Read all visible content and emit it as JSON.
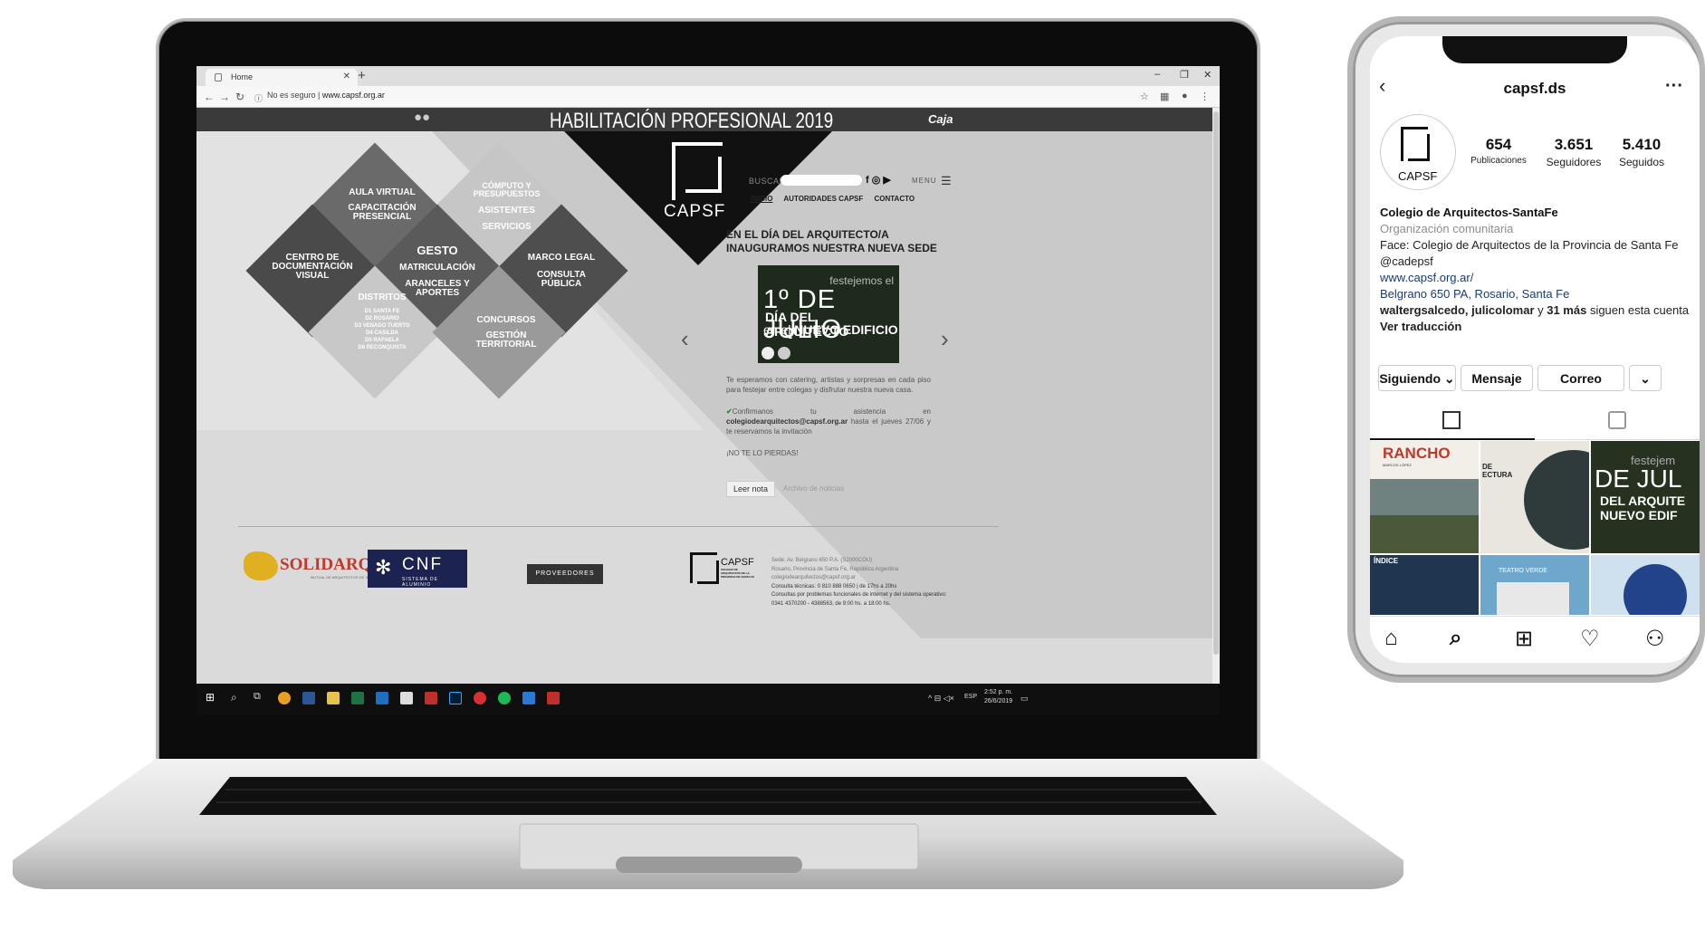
{
  "browser": {
    "tab_title": "Home",
    "new_tab": "+",
    "security_label": "No es seguro",
    "url": "www.capsf.org.ar",
    "window_controls": [
      "–",
      "❐",
      "✕"
    ]
  },
  "site": {
    "banner_title": "HABILITACIÓN PROFESIONAL 2019",
    "banner_sponsor": "Caja",
    "logo_text": "CAPSF",
    "search_label": "BUSCAR",
    "menu_label": "MENU",
    "nav": [
      "INICIO",
      "AUTORIDADES CAPSF",
      "CONTACTO"
    ],
    "diamonds": {
      "aula": "AULA VIRTUAL",
      "capacitacion": "CAPACITACIÓN PRESENCIAL",
      "computo": "CÓMPUTO Y PRESUPUESTOS",
      "asistentes": "ASISTENTES",
      "servicios": "SERVICIOS",
      "centro": "CENTRO DE DOCUMENTACIÓN VISUAL",
      "gesto": "GESTO",
      "matriculacion": "MATRICULACIÓN",
      "aranceles": "ARANCELES Y APORTES",
      "marco": "MARCO LEGAL",
      "consulta": "CONSULTA PÚBLICA",
      "distritos": "DISTRITOS",
      "distritos_list": [
        "D1 SANTA FE",
        "D2 ROSARIO",
        "D3 VENADO TUERTO",
        "D4 CASILDA",
        "D5 RAFAELA",
        "D6 RECONQUISTA"
      ],
      "concursos": "CONCURSOS",
      "gestion": "GESTIÓN TERRITORIAL"
    },
    "news": {
      "headline": "EN EL DÍA DEL ARQUITECTO/A INAUGURAMOS NUESTRA NUEVA SEDE",
      "promo_line1": "festejemos el",
      "promo_line2": "1º DE JULIO",
      "promo_line3": "DÍA DEL ARQUITECTO",
      "promo_line4a": "en el",
      "promo_line4b": "NUEVO EDIFICIO",
      "body": "Te esperamos con catering, artistas y sorpresas en cada piso para festejar entre colegas y disfrutar nuestra nueva casa.",
      "confirm_a": "Confirmanos tu asistencia en",
      "confirm_email": "colegiodearquitectos@capsf.org.ar",
      "confirm_b": "hasta el jueves 27/06 y te reservamos la invitación",
      "closing": "¡NO TE LO PIERDAS!",
      "read_more": "Leer nota",
      "archive": "Archivo de noticias"
    },
    "footer": {
      "solidarq": "SOLIDARQ",
      "solidarq_sub": "MUTUAL DE ARQUITECTOS DE SANTA FE",
      "cnf": "CNF",
      "cnf_sub": "SISTEMA DE ALUMINIO",
      "providers": "PROVEEDORES",
      "logo_text": "CAPSF",
      "logo_sub": "COLEGIO DE ARQUITECTOS DE LA PROVINCIA DE SANTA FE",
      "contact": [
        "Sede: Av. Belgrano 650 P.A. (S2000COU)",
        "Rosario, Provincia de Santa Fe, República Argentina",
        "colegiodearquitectos@capsf.org.ar",
        "Consulta técnicas: 0 810 888 0650 | de 17hs a 20hs",
        "Consultas por problemas funcionales de internet y del sistema operativo:",
        "0341 4370200 - 4388563, de 9:00 hs. a 18:00 hs."
      ]
    }
  },
  "taskbar": {
    "lang": "ESP",
    "time": "2:52 p. m.",
    "date": "26/6/2019"
  },
  "instagram": {
    "username": "capsf.ds",
    "avatar_text": "CAPSF",
    "stats": [
      {
        "value": "654",
        "label": "Publicaciones"
      },
      {
        "value": "3.651",
        "label": "Seguidores"
      },
      {
        "value": "5.410",
        "label": "Seguidos"
      }
    ],
    "name": "Colegio de Arquitectos-SantaFe",
    "category": "Organización comunitaria",
    "bio": "Face: Colegio de Arquitectos de la Provincia de Santa Fe @cadepsf",
    "website": "www.capsf.org.ar/",
    "address": "Belgrano 650 PA, Rosario, Santa Fe",
    "followers_a": "waltergsalcedo, julicolomar",
    "followers_b": " y ",
    "followers_c": "31 más",
    "followers_d": " siguen esta cuenta",
    "translate": "Ver traducción",
    "buttons": [
      "Siguiendo ⌄",
      "Mensaje",
      "Correo",
      "⌄"
    ],
    "posts": {
      "p1_title": "RANCHO",
      "p1_sub": "MARCOS LÓPEZ",
      "p2_text": "DE ECTURA",
      "p3_line1": "festejem",
      "p3_line2": "DE JUL",
      "p3_line3": "DEL ARQUITE",
      "p3_line4": "NUEVO EDIF",
      "p4_text": "ÍNDICE",
      "p5_text": "TEATRO VERDE"
    }
  },
  "colors": {
    "banner": "#3a3a3a",
    "ig_link": "#1a3c73",
    "dark_diamond": "#555555",
    "light_diamond": "#bcbcbc",
    "promo_bg": "#1e2a1c",
    "check": "#2a8a2a"
  }
}
